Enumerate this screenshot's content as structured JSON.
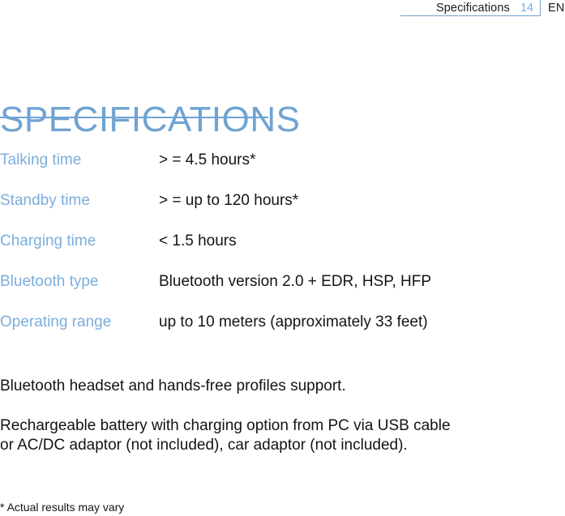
{
  "header": {
    "section_name": "Specifications",
    "page_number": "14",
    "language": "EN",
    "accent_color": "#6FA3D3"
  },
  "title": {
    "text": "SPECIFICATIONS",
    "color": "#6FA3D3"
  },
  "specs": {
    "rows": [
      {
        "label": "Talking time",
        "value": "> = 4.5 hours*"
      },
      {
        "label": "Standby time",
        "value": "> = up to 120 hours*"
      },
      {
        "label": "Charging time",
        "value": "< 1.5 hours"
      },
      {
        "label": "Bluetooth type",
        "value": "Bluetooth version 2.0 + EDR, HSP, HFP"
      },
      {
        "label": "Operating range",
        "value": "up to 10 meters (approximately 33 feet)"
      }
    ]
  },
  "notes": {
    "paragraph_1": "Bluetooth headset and hands-free profiles support.",
    "paragraph_2": "Rechargeable battery with charging option from PC via USB cable\nor AC/DC adaptor (not included), car adaptor (not included)."
  },
  "footnote": {
    "text": "* Actual results may vary"
  }
}
